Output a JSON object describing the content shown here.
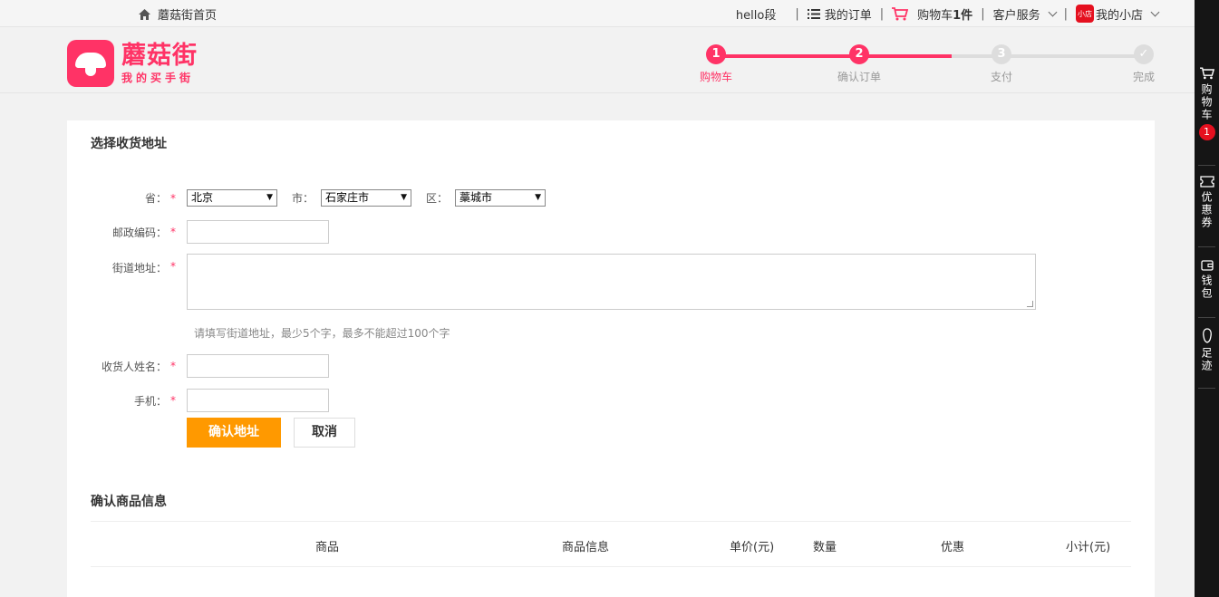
{
  "topbar": {
    "home_label": "蘑菇街首页",
    "greeting": "hello段",
    "orders_label": "我的订单",
    "cart_label": "购物车",
    "cart_count": "1件",
    "service_label": "客户服务",
    "shop_badge": "小店",
    "shop_label": "我的小店"
  },
  "logo": {
    "name": "蘑菇街",
    "slogan": "我的买手街"
  },
  "steps": [
    {
      "num": "1",
      "label": "购物车"
    },
    {
      "num": "2",
      "label": "确认订单"
    },
    {
      "num": "3",
      "label": "支付"
    },
    {
      "num": "✓",
      "label": "完成"
    }
  ],
  "address": {
    "title": "选择收货地址",
    "province_label": "省：",
    "province_value": "北京",
    "city_label": "市：",
    "city_value": "石家庄市",
    "district_label": "区：",
    "district_value": "藁城市",
    "postcode_label": "邮政编码：",
    "street_label": "街道地址：",
    "street_hint": "请填写街道地址，最少5个字，最多不能超过100个字",
    "name_label": "收货人姓名：",
    "phone_label": "手机：",
    "required_mark": "*",
    "confirm_button": "确认地址",
    "cancel_button": "取消"
  },
  "goods": {
    "title": "确认商品信息",
    "columns": [
      "商品",
      "商品信息",
      "单价(元)",
      "数量",
      "优惠",
      "小计(元)"
    ]
  },
  "sidebar": {
    "cart_label": "购物车",
    "cart_badge": "1",
    "coupon_label": "优惠券",
    "wallet_label": "钱包",
    "history_label": "足迹"
  },
  "colors": {
    "brand": "#ff3366",
    "confirm": "#ff9900",
    "sidebar": "#151515"
  }
}
